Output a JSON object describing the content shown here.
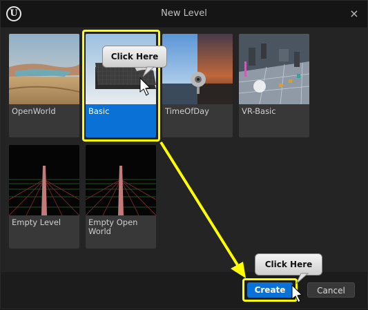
{
  "window": {
    "title": "New Level",
    "close_icon": "×",
    "logo_glyph": "U"
  },
  "templates": [
    {
      "label": "OpenWorld",
      "selected": false
    },
    {
      "label": "Basic",
      "selected": true
    },
    {
      "label": "TimeOfDay",
      "selected": false
    },
    {
      "label": "VR-Basic",
      "selected": false
    },
    {
      "label": "Empty Level",
      "selected": false
    },
    {
      "label": "Empty Open World",
      "selected": false
    }
  ],
  "footer": {
    "create_label": "Create",
    "cancel_label": "Cancel"
  },
  "annotations": {
    "callout_basic": "Click Here",
    "callout_create": "Click Here",
    "highlight_color": "#ffff00"
  },
  "colors": {
    "accent": "#0a72d6",
    "tile_bg": "#383838",
    "panel_bg": "#242424"
  }
}
